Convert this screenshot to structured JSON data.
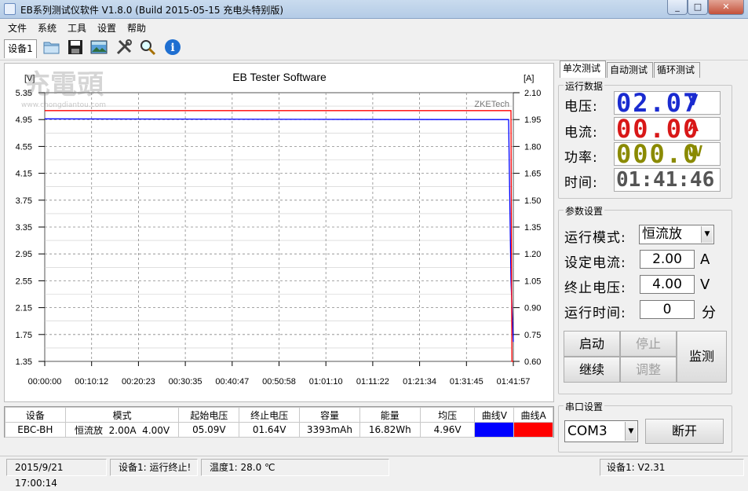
{
  "window": {
    "title": "EB系列测试仪软件 V1.8.0 (Build 2015-05-15 充电头特别版)",
    "min": "_",
    "max": "□",
    "close": "✕"
  },
  "menu": [
    "文件",
    "系统",
    "工具",
    "设置",
    "帮助"
  ],
  "toolbar": {
    "device_tab": "设备1",
    "icons": [
      "folder-icon",
      "save-icon",
      "picture-icon",
      "tools-icon",
      "zoom-icon",
      "info-icon"
    ]
  },
  "chart_data": {
    "type": "line",
    "title": "EB Tester Software",
    "brand": "ZKETech",
    "ylabel_left": "[V]",
    "ylabel_right": "[A]",
    "ylim_left": [
      1.35,
      5.35
    ],
    "ylim_right": [
      0.6,
      2.1
    ],
    "yticks_left": [
      "5.35",
      "4.95",
      "4.55",
      "4.15",
      "3.75",
      "3.35",
      "2.95",
      "2.55",
      "2.15",
      "1.75",
      "1.35"
    ],
    "yticks_right": [
      "2.10",
      "1.95",
      "1.80",
      "1.65",
      "1.50",
      "1.35",
      "1.20",
      "1.05",
      "0.90",
      "0.75",
      "0.60"
    ],
    "xticks": [
      "00:00:00",
      "00:10:12",
      "00:20:23",
      "00:30:35",
      "00:40:47",
      "00:50:58",
      "01:01:10",
      "01:11:22",
      "01:21:34",
      "01:31:45",
      "01:41:57"
    ],
    "grid": true,
    "series": [
      {
        "name": "曲线V",
        "color": "#0000ff",
        "axis": "left",
        "points": [
          [
            0,
            4.96
          ],
          [
            0.9,
            4.95
          ],
          [
            0.99,
            4.95
          ],
          [
            0.995,
            2.55
          ],
          [
            1.0,
            1.64
          ]
        ]
      },
      {
        "name": "曲线A",
        "color": "#ff0000",
        "axis": "right",
        "points": [
          [
            0,
            2.0
          ],
          [
            0.995,
            2.0
          ],
          [
            0.997,
            0.6
          ],
          [
            1.0,
            0.6
          ]
        ]
      }
    ]
  },
  "watermark": {
    "text": "充電頭",
    "subtext": "www.chongdiantou.com"
  },
  "table": {
    "headers": [
      "设备",
      "模式",
      "起始电压",
      "终止电压",
      "容量",
      "能量",
      "均压",
      "曲线V",
      "曲线A"
    ],
    "row": [
      "EBC-BH",
      "恒流放  2.00A  4.00V",
      "05.09V",
      "01.64V",
      "3393mAh",
      "16.82Wh",
      "4.96V",
      "",
      ""
    ],
    "swatch_v": "#0000ff",
    "swatch_a": "#ff0000"
  },
  "status": {
    "datetime": "2015/9/21 17:00:14",
    "device_state": "设备1: 运行终止!",
    "temperature": "温度1: 28.0 ℃",
    "version": "设备1: V2.31"
  },
  "tabs": [
    "单次测试",
    "自动测试",
    "循环测试"
  ],
  "run_data": {
    "title": "运行数据",
    "voltage": {
      "label": "电压:",
      "value": "02.07",
      "unit": "V",
      "color": "#1a2bd0"
    },
    "current": {
      "label": "电流:",
      "value": "00.00",
      "unit": "A",
      "color": "#d81818"
    },
    "power": {
      "label": "功率:",
      "value": "000.0",
      "unit": "W",
      "color": "#8a8a00"
    },
    "time": {
      "label": "时间:",
      "value": "01:41:46",
      "color": "#555555"
    }
  },
  "params": {
    "title": "参数设置",
    "mode_label": "运行模式:",
    "mode_value": "恒流放",
    "current_label": "设定电流:",
    "current_value": "2.00",
    "current_unit": "A",
    "cutoff_label": "终止电压:",
    "cutoff_value": "4.00",
    "cutoff_unit": "V",
    "time_label": "运行时间:",
    "time_value": "0",
    "time_unit": "分"
  },
  "buttons": {
    "start": "启动",
    "stop": "停止",
    "resume": "继续",
    "adjust": "调整",
    "monitor": "监测"
  },
  "serial": {
    "title": "串口设置",
    "port": "COM3",
    "disconnect": "断开"
  }
}
